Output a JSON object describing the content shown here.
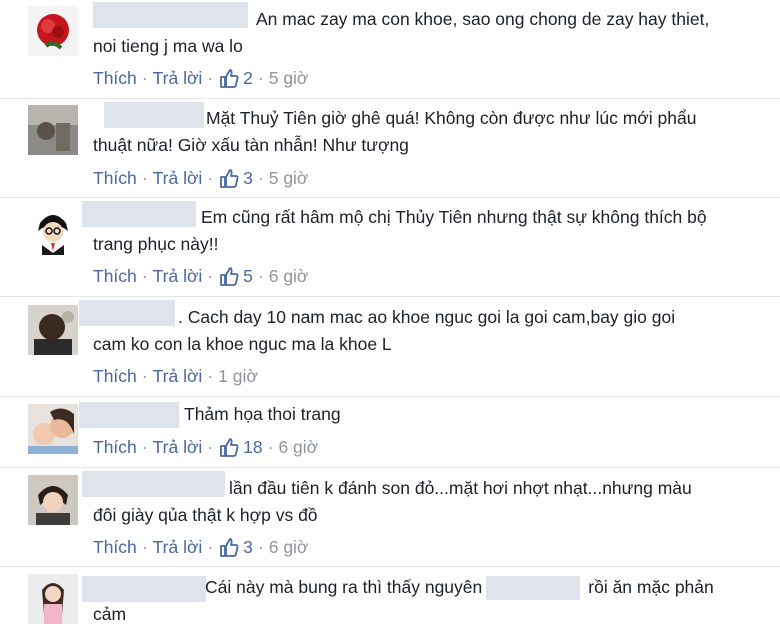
{
  "labels": {
    "like": "Thích",
    "reply": "Trả lời",
    "sep": "·"
  },
  "comments": [
    {
      "text": "An mac zay ma con khoe, sao ong chong de zay hay thiet,\nnoi tieng j ma wa lo",
      "likes": "2",
      "time": "5 giờ"
    },
    {
      "text": "Mặt Thuỷ Tiên giờ ghê quá! Không còn được như lúc mới phẩu\nthuật nữa! Giờ xấu tàn nhẫn! Như tượng",
      "likes": "3",
      "time": "5 giờ"
    },
    {
      "text": "Em cũng rất hâm mộ chị Thủy Tiên nhưng thật sự không thích bộ\ntrang phục này!!",
      "likes": "5",
      "time": "6 giờ"
    },
    {
      "text": ". Cach day 10 nam mac ao khoe nguc goi la goi cam,bay gio goi\ncam ko con la khoe nguc ma la khoe L",
      "likes": "",
      "time": "1 giờ"
    },
    {
      "text": "Thảm họa thoi trang",
      "likes": "18",
      "time": "6 giờ"
    },
    {
      "text": "lần đầu tiên k đánh son đỏ...mặt hơi nhợt nhạt...nhưng màu\nđôi giày qủa thật k hợp vs đồ",
      "likes": "3",
      "time": "6 giờ"
    },
    {
      "text_before": "Cái này mà bung ra thì thấy nguyên",
      "text_after": "rồi ăn mặc phản\ncảm"
    }
  ],
  "colors": {
    "link": "#4b67a1",
    "meta": "#90949c",
    "text": "#1d2129",
    "blur": "#dfe3ec"
  }
}
